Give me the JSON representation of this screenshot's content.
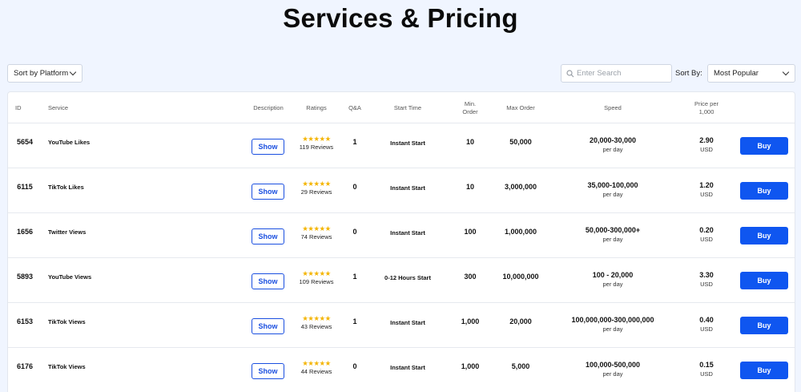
{
  "page": {
    "title": "Services & Pricing"
  },
  "filters": {
    "platform_label": "Sort by Platform",
    "search_placeholder": "Enter Search",
    "sort_label": "Sort By:",
    "sort_value": "Most Popular"
  },
  "table": {
    "headers": {
      "id": "ID",
      "service": "Service",
      "description": "Description",
      "ratings": "Ratings",
      "qa": "Q&A",
      "start_time": "Start Time",
      "min_order": "Min.\nOrder",
      "max_order": "Max Order",
      "speed": "Speed",
      "price": "Price per\n1,000"
    },
    "show_label": "Show",
    "buy_label": "Buy",
    "speed_unit": "per day",
    "currency": "USD",
    "rows": [
      {
        "id": "5654",
        "service": "YouTube Likes",
        "stars": "★★★★★",
        "reviews": "119 Reviews",
        "qa": "1",
        "start": "Instant Start",
        "min": "10",
        "max": "50,000",
        "speed": "20,000-30,000",
        "price": "2.90"
      },
      {
        "id": "6115",
        "service": "TikTok Likes",
        "stars": "★★★★★",
        "reviews": "29 Reviews",
        "qa": "0",
        "start": "Instant Start",
        "min": "10",
        "max": "3,000,000",
        "speed": "35,000-100,000",
        "price": "1.20"
      },
      {
        "id": "1656",
        "service": "Twitter Views",
        "stars": "★★★★★",
        "reviews": "74 Reviews",
        "qa": "0",
        "start": "Instant Start",
        "min": "100",
        "max": "1,000,000",
        "speed": "50,000-300,000+",
        "price": "0.20"
      },
      {
        "id": "5893",
        "service": "YouTube Views",
        "stars": "★★★★★",
        "reviews": "109 Reviews",
        "qa": "1",
        "start": "0-12 Hours Start",
        "min": "300",
        "max": "10,000,000",
        "speed": "100 - 20,000",
        "price": "3.30"
      },
      {
        "id": "6153",
        "service": "TikTok Views",
        "stars": "★★★★★",
        "reviews": "43 Reviews",
        "qa": "1",
        "start": "Instant Start",
        "min": "1,000",
        "max": "20,000",
        "speed": "100,000,000-300,000,000",
        "price": "0.40"
      },
      {
        "id": "6176",
        "service": "TikTok Views",
        "stars": "★★★★★",
        "reviews": "44 Reviews",
        "qa": "0",
        "start": "Instant Start",
        "min": "1,000",
        "max": "5,000",
        "speed": "100,000-500,000",
        "price": "0.15"
      }
    ]
  },
  "colors": {
    "accent": "#0f56f0",
    "star": "#f4b400",
    "background": "#f0f5ff"
  },
  "icons": {
    "search": "search-icon",
    "dropdown": "chevron-down-icon",
    "rating": "star-icon"
  }
}
